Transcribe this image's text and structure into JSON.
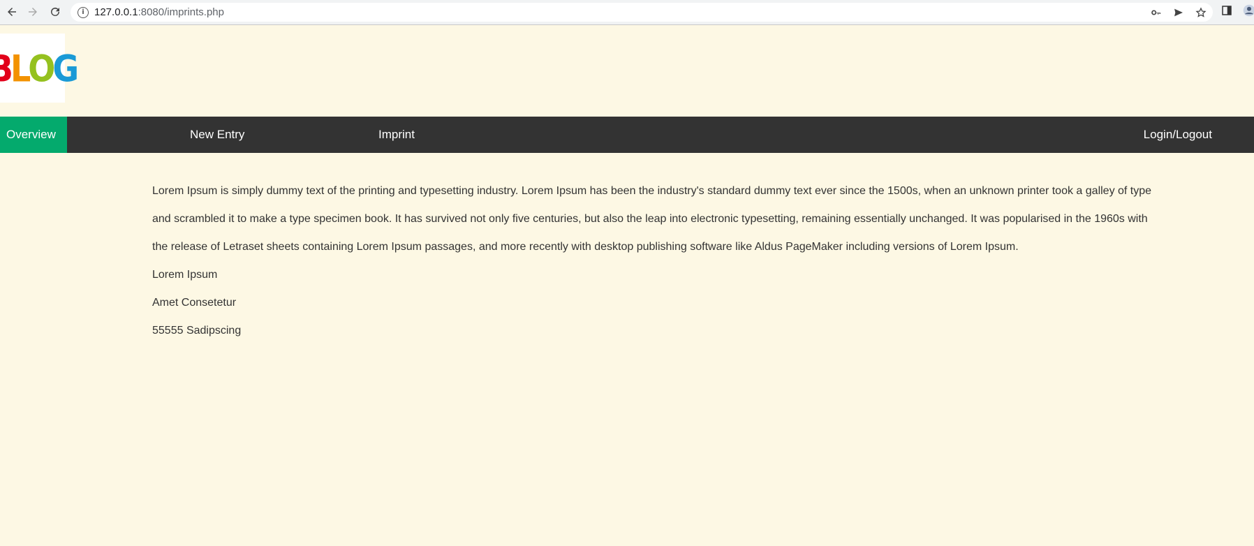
{
  "browser": {
    "url_host": "127.0.0.1",
    "url_rest": ":8080/imprints.php"
  },
  "logo": {
    "letters": [
      "B",
      "L",
      "O",
      "G"
    ]
  },
  "nav": {
    "overview": "Overview",
    "new_entry": "New Entry",
    "imprint": "Imprint",
    "login": "Login/Logout"
  },
  "content": {
    "paragraph": "Lorem Ipsum is simply dummy text of the printing and typesetting industry. Lorem Ipsum has been the industry's standard dummy text ever since the 1500s, when an unknown printer took a galley of type and scrambled it to make a type specimen book. It has survived not only five centuries, but also the leap into electronic typesetting, remaining essentially unchanged. It was popularised in the 1960s with the release of Letraset sheets containing Lorem Ipsum passages, and more recently with desktop publishing software like Aldus PageMaker including versions of Lorem Ipsum.",
    "name": "Lorem Ipsum",
    "street": "Amet Consetetur",
    "city": "55555 Sadipscing"
  },
  "colors": {
    "page_bg": "#fdf8e4",
    "navbar_bg": "#333333",
    "active_nav_bg": "#04aa6d"
  },
  "icons": [
    "back-icon",
    "forward-icon",
    "reload-icon",
    "info-icon",
    "key-icon",
    "send-icon",
    "star-icon",
    "sidebar-icon",
    "profile-icon"
  ]
}
